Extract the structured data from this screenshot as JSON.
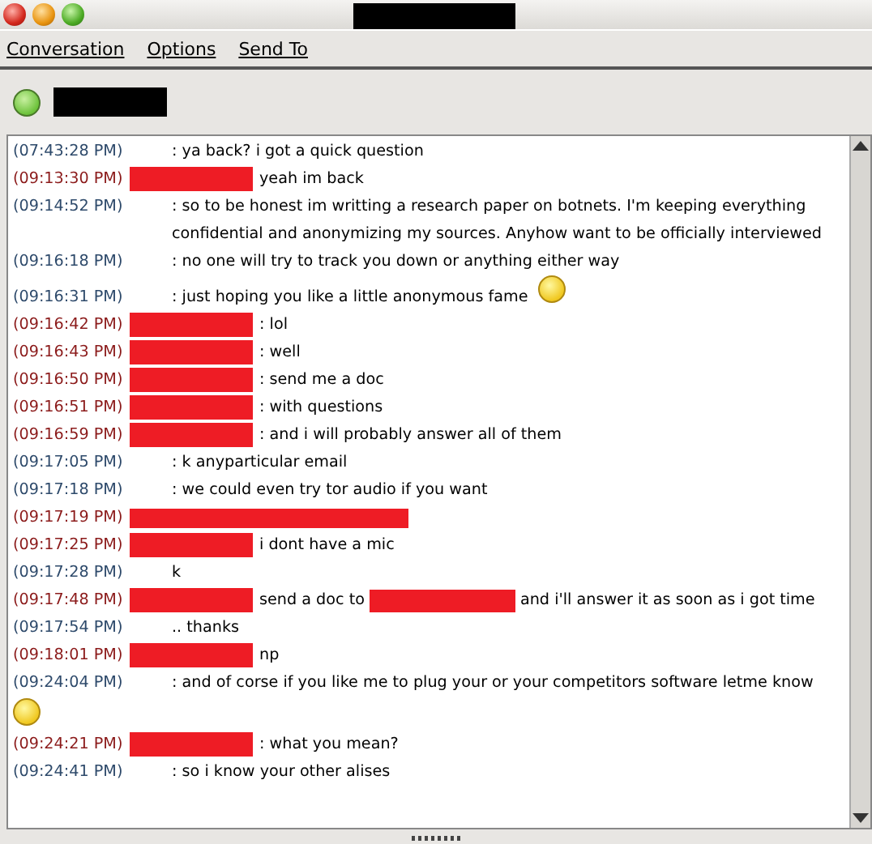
{
  "menu": [
    {
      "label": "Conversation"
    },
    {
      "label": "Options"
    },
    {
      "label": "Send To"
    }
  ],
  "buddy": {
    "online": true
  },
  "messages": [
    {
      "time": "(07:43:28 PM)",
      "kind": "local",
      "text": ": ya back? i got a quick question"
    },
    {
      "time": "(09:13:30 PM)",
      "kind": "remote",
      "text": "yeah im back"
    },
    {
      "time": "(09:14:52 PM)",
      "kind": "local",
      "text": ": so to be honest im writting a research paper on botnets. I'm keeping everything confidential and anonymizing my sources. Anyhow want to be officially interviewed"
    },
    {
      "time": "(09:16:18 PM)",
      "kind": "local",
      "text": ": no one will try to track you down or anything either way"
    },
    {
      "time": "(09:16:31 PM)",
      "kind": "local",
      "text": ": just hoping you like a little anonymous fame",
      "emoticon_inline": true
    },
    {
      "time": "(09:16:42 PM)",
      "kind": "remote",
      "text": ": lol"
    },
    {
      "time": "(09:16:43 PM)",
      "kind": "remote",
      "text": ": well"
    },
    {
      "time": "(09:16:50 PM)",
      "kind": "remote",
      "text": ": send me a doc"
    },
    {
      "time": "(09:16:51 PM)",
      "kind": "remote",
      "text": ": with questions"
    },
    {
      "time": "(09:16:59 PM)",
      "kind": "remote",
      "text": ": and i will probably answer all of them"
    },
    {
      "time": "(09:17:05 PM)",
      "kind": "local",
      "text": ": k anyparticular email"
    },
    {
      "time": "(09:17:18 PM)",
      "kind": "local",
      "text": ": we could even try tor audio if you want"
    },
    {
      "time": "(09:17:19 PM)",
      "kind": "remote_redacted"
    },
    {
      "time": "(09:17:25 PM)",
      "kind": "remote",
      "text": "i dont have a mic"
    },
    {
      "time": "(09:17:28 PM)",
      "kind": "local",
      "text": "k"
    },
    {
      "time": "(09:17:48 PM)",
      "kind": "remote",
      "text": "send a doc to",
      "text_after": "and i'll answer it as soon as i got time"
    },
    {
      "time": "(09:17:54 PM)",
      "kind": "local",
      "text": ".. thanks"
    },
    {
      "time": "(09:18:01 PM)",
      "kind": "remote",
      "text": "np"
    },
    {
      "time": "(09:24:04 PM)",
      "kind": "local",
      "text": ": and  of corse if you like me to plug your or your competitors software letme know",
      "emoticon_below": true
    },
    {
      "time": "(09:24:21 PM)",
      "kind": "remote",
      "text": ": what you mean?"
    },
    {
      "time": "(09:24:41 PM)",
      "kind": "local",
      "text": ": so i know your other alises"
    }
  ]
}
